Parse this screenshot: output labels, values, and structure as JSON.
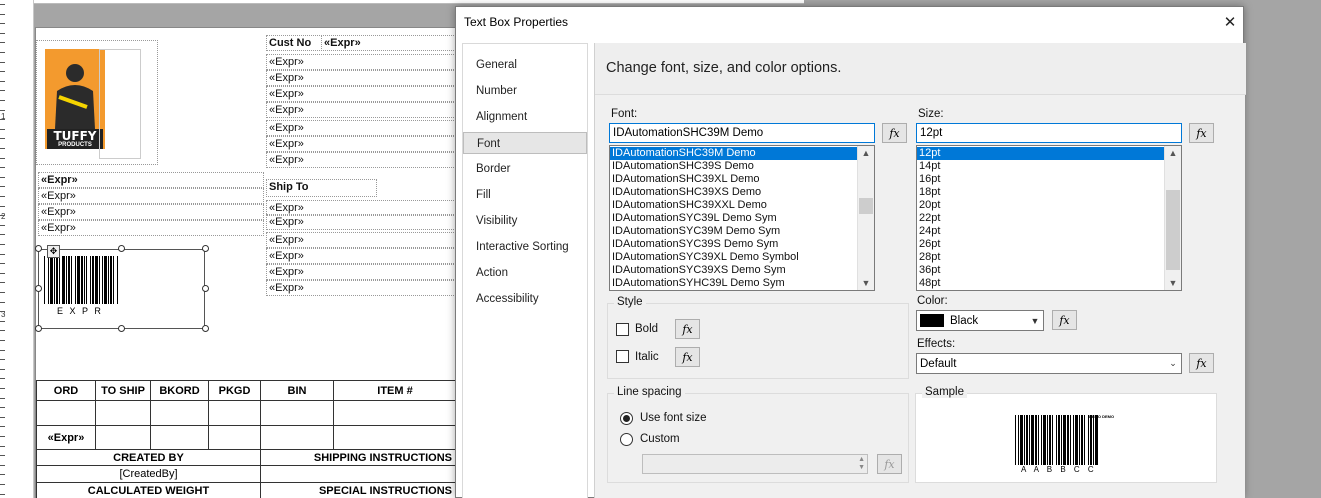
{
  "report": {
    "logo": {
      "line1": "TUFFY",
      "line2": "PRODUCTS"
    },
    "cust_no_label": "Cust No",
    "expr": "«Expr»",
    "ship_to_label": "Ship To",
    "barcode_text": "E X P R",
    "ruler_marks": [
      "1",
      "2",
      "3"
    ],
    "table_headers": [
      "ORD",
      "TO SHIP",
      "BKORD",
      "PKGD",
      "BIN",
      "ITEM #"
    ],
    "created_by_label": "CREATED BY",
    "created_by_value": "[CreatedBy]",
    "shipping_instructions_label": "SHIPPING INSTRUCTIONS",
    "calculated_weight_label": "CALCULATED WEIGHT",
    "special_instructions_label": "SPECIAL INSTRUCTIONS"
  },
  "dialog": {
    "title": "Text Box Properties",
    "close_glyph": "✕",
    "nav": [
      "General",
      "Number",
      "Alignment",
      "Font",
      "Border",
      "Fill",
      "Visibility",
      "Interactive Sorting",
      "Action",
      "Accessibility"
    ],
    "selected_nav": "Font",
    "header": "Change font, size, and color options.",
    "fx_glyph": "fx",
    "font": {
      "label": "Font:",
      "value": "IDAutomationSHC39M Demo",
      "options": [
        "IDAutomationSHC39M Demo",
        "IDAutomationSHC39S Demo",
        "IDAutomationSHC39XL Demo",
        "IDAutomationSHC39XS Demo",
        "IDAutomationSHC39XXL Demo",
        "IDAutomationSYC39L Demo Sym",
        "IDAutomationSYC39M Demo Sym",
        "IDAutomationSYC39S Demo Sym",
        "IDAutomationSYC39XL Demo Symbol",
        "IDAutomationSYC39XS Demo Sym",
        "IDAutomationSYHC39L Demo Sym"
      ]
    },
    "size": {
      "label": "Size:",
      "value": "12pt",
      "options": [
        "12pt",
        "14pt",
        "16pt",
        "18pt",
        "20pt",
        "22pt",
        "24pt",
        "26pt",
        "28pt",
        "36pt",
        "48pt"
      ]
    },
    "style": {
      "title": "Style",
      "bold": "Bold",
      "italic": "Italic",
      "bold_checked": false,
      "italic_checked": false
    },
    "color": {
      "label": "Color:",
      "value": "Black",
      "swatch": "#000000"
    },
    "effects": {
      "label": "Effects:",
      "value": "Default"
    },
    "line_spacing": {
      "title": "Line spacing",
      "use_font_size": "Use font size",
      "custom": "Custom",
      "selected": "Use font size",
      "custom_value": ""
    },
    "sample": {
      "title": "Sample",
      "caption": "A A B B C C",
      "tag": "DEMO DEMO"
    }
  },
  "colors": {
    "accent": "#0078d7",
    "panel": "#f0f0f0"
  }
}
